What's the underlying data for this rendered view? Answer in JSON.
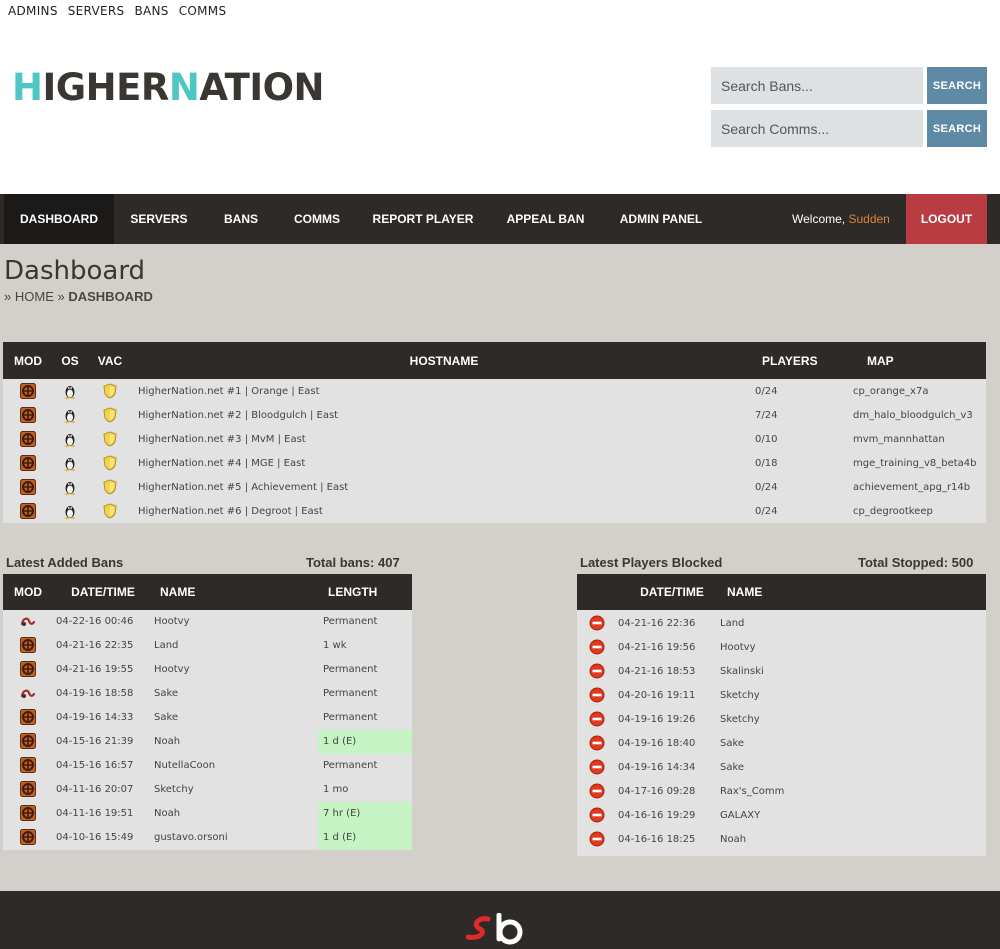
{
  "toplinks": [
    "ADMINS",
    "SERVERS",
    "BANS",
    "COMMS"
  ],
  "logo": {
    "part1": "H",
    "part2": "IGHER",
    "part3": "N",
    "part4": "ATION"
  },
  "search": {
    "bans_placeholder": "Search Bans...",
    "comms_placeholder": "Search Comms...",
    "button_label": "SEARCH"
  },
  "nav": {
    "tabs": [
      "DASHBOARD",
      "SERVERS",
      "BANS",
      "COMMS",
      "REPORT PLAYER",
      "APPEAL BAN",
      "ADMIN PANEL"
    ],
    "welcome_prefix": "Welcome, ",
    "username": "Sudden",
    "logout": "LOGOUT"
  },
  "page": {
    "title": "Dashboard",
    "crumb_sep": "»",
    "crumb_home": "HOME",
    "crumb_current": "DASHBOARD"
  },
  "servers": {
    "headers": {
      "mod": "MOD",
      "os": "OS",
      "vac": "VAC",
      "hostname": "HOSTNAME",
      "players": "PLAYERS",
      "map": "MAP"
    },
    "rows": [
      {
        "hostname": "HigherNation.net #1 | Orange | East",
        "players": "0/24",
        "map": "cp_orange_x7a"
      },
      {
        "hostname": "HigherNation.net #2 | Bloodgulch | East",
        "players": "7/24",
        "map": "dm_halo_bloodgulch_v3"
      },
      {
        "hostname": "HigherNation.net #3 | MvM | East",
        "players": "0/10",
        "map": "mvm_mannhattan"
      },
      {
        "hostname": "HigherNation.net #4 | MGE | East",
        "players": "0/18",
        "map": "mge_training_v8_beta4b"
      },
      {
        "hostname": "HigherNation.net #5 | Achievement | East",
        "players": "0/24",
        "map": "achievement_apg_r14b"
      },
      {
        "hostname": "HigherNation.net #6 | Degroot | East",
        "players": "0/24",
        "map": "cp_degrootkeep"
      }
    ]
  },
  "bans": {
    "title": "Latest Added Bans",
    "total_label": "Total bans: 407",
    "headers": {
      "mod": "MOD",
      "datetime": "DATE/TIME",
      "name": "NAME",
      "length": "LENGTH"
    },
    "rows": [
      {
        "mod": "hl2dm",
        "datetime": "04-22-16 00:46",
        "name": "Hootvy",
        "length": "Permanent",
        "expired": false
      },
      {
        "mod": "tf2",
        "datetime": "04-21-16 22:35",
        "name": "Land",
        "length": "1 wk",
        "expired": false
      },
      {
        "mod": "tf2",
        "datetime": "04-21-16 19:55",
        "name": "Hootvy",
        "length": "Permanent",
        "expired": false
      },
      {
        "mod": "hl2dm",
        "datetime": "04-19-16 18:58",
        "name": "Sake",
        "length": "Permanent",
        "expired": false
      },
      {
        "mod": "tf2",
        "datetime": "04-19-16 14:33",
        "name": "Sake",
        "length": "Permanent",
        "expired": false
      },
      {
        "mod": "tf2",
        "datetime": "04-15-16 21:39",
        "name": "Noah",
        "length": "1 d (E)",
        "expired": true
      },
      {
        "mod": "tf2",
        "datetime": "04-15-16 16:57",
        "name": "NutellaCoon",
        "length": "Permanent",
        "expired": false
      },
      {
        "mod": "tf2",
        "datetime": "04-11-16 20:07",
        "name": "Sketchy",
        "length": "1 mo",
        "expired": false
      },
      {
        "mod": "tf2",
        "datetime": "04-11-16 19:51",
        "name": "Noah",
        "length": "7 hr (E)",
        "expired": true
      },
      {
        "mod": "tf2",
        "datetime": "04-10-16 15:49",
        "name": "gustavo.orsoni",
        "length": "1 d (E)",
        "expired": true
      }
    ]
  },
  "blocks": {
    "title": "Latest Players Blocked",
    "total_label": "Total Stopped: 500",
    "headers": {
      "datetime": "DATE/TIME",
      "name": "NAME"
    },
    "rows": [
      {
        "datetime": "04-21-16 22:36",
        "name": "Land"
      },
      {
        "datetime": "04-21-16 19:56",
        "name": "Hootvy"
      },
      {
        "datetime": "04-21-16 18:53",
        "name": "Skalinski"
      },
      {
        "datetime": "04-20-16 19:11",
        "name": "Sketchy"
      },
      {
        "datetime": "04-19-16 19:26",
        "name": "Sketchy"
      },
      {
        "datetime": "04-19-16 18:40",
        "name": "Sake"
      },
      {
        "datetime": "04-19-16 14:34",
        "name": "Sake"
      },
      {
        "datetime": "04-17-16 09:28",
        "name": "Rax's_Comm"
      },
      {
        "datetime": "04-16-16 19:29",
        "name": "GALAXY"
      },
      {
        "datetime": "04-16-16 18:25",
        "name": "Noah"
      }
    ]
  },
  "colors": {
    "accent_teal": "#4ec6c4",
    "nav_dark": "#2e2a27",
    "logout_red": "#b93c42",
    "search_blue": "#5e8aa6",
    "username_orange": "#e0823f",
    "expired_green": "#c6f3c4"
  },
  "icons": {
    "mod_tf2": "tf2-icon",
    "mod_hl2dm": "hl2dm-icon",
    "os": "linux-icon",
    "vac": "vac-shield-icon",
    "blocked": "blocked-icon",
    "footer_logo": "sourcebans-logo"
  }
}
